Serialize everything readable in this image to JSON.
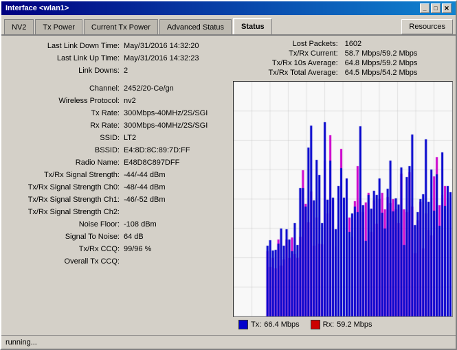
{
  "window": {
    "title": "Interface <wlan1>",
    "title_btn_minimize": "_",
    "title_btn_restore": "□",
    "title_btn_close": "✕"
  },
  "tabs": [
    {
      "id": "nv2",
      "label": "NV2",
      "active": false
    },
    {
      "id": "tx-power",
      "label": "Tx Power",
      "active": false
    },
    {
      "id": "current-tx-power",
      "label": "Current Tx Power",
      "active": false
    },
    {
      "id": "advanced-status",
      "label": "Advanced Status",
      "active": false
    },
    {
      "id": "status",
      "label": "Status",
      "active": true
    }
  ],
  "resources_btn": "Resources",
  "stats": {
    "lost_packets_label": "Lost Packets:",
    "lost_packets_value": "1602",
    "tx_rx_current_label": "Tx/Rx Current:",
    "tx_rx_current_value": "58.7 Mbps/59.2 Mbps",
    "tx_rx_10s_label": "Tx/Rx 10s Average:",
    "tx_rx_10s_value": "64.8 Mbps/59.2 Mbps",
    "tx_rx_total_label": "Tx/Rx Total Average:",
    "tx_rx_total_value": "64.5 Mbps/54.2 Mbps"
  },
  "fields": [
    {
      "label": "Last Link Down Time:",
      "value": "May/31/2016 14:32:20"
    },
    {
      "label": "Last Link Up Time:",
      "value": "May/31/2016 14:32:23"
    },
    {
      "label": "Link Downs:",
      "value": "2"
    },
    {
      "label": "",
      "value": ""
    },
    {
      "label": "Channel:",
      "value": "2452/20-Ce/gn"
    },
    {
      "label": "Wireless Protocol:",
      "value": "nv2"
    },
    {
      "label": "Tx Rate:",
      "value": "300Mbps-40MHz/2S/SGI"
    },
    {
      "label": "Rx Rate:",
      "value": "300Mbps-40MHz/2S/SGI"
    },
    {
      "label": "SSID:",
      "value": "LT2"
    },
    {
      "label": "BSSID:",
      "value": "E4:8D:8C:89:7D:FF"
    },
    {
      "label": "Radio Name:",
      "value": "E48D8C897DFF"
    },
    {
      "label": "Tx/Rx Signal Strength:",
      "value": "-44/-44 dBm"
    },
    {
      "label": "Tx/Rx Signal Strength Ch0:",
      "value": "-48/-44 dBm"
    },
    {
      "label": "Tx/Rx Signal Strength Ch1:",
      "value": "-46/-52 dBm"
    },
    {
      "label": "Tx/Rx Signal Strength Ch2:",
      "value": ""
    },
    {
      "label": "Noise Floor:",
      "value": "-108 dBm"
    },
    {
      "label": "Signal To Noise:",
      "value": "64 dB"
    },
    {
      "label": "Tx/Rx CCQ:",
      "value": "99/96 %"
    },
    {
      "label": "Overall Tx CCQ:",
      "value": ""
    }
  ],
  "legend": {
    "tx_color": "#0000cc",
    "rx_color": "#cc0000",
    "tx_label": "Tx:",
    "tx_value": "66.4 Mbps",
    "rx_label": "Rx:",
    "rx_value": "59.2 Mbps"
  },
  "status_bar": {
    "text": "running..."
  },
  "chart": {
    "grid_color": "#c0c0c0",
    "bg_color": "#f8f8f8",
    "tx_color": "#0000cc",
    "rx_color": "#cc00cc"
  }
}
